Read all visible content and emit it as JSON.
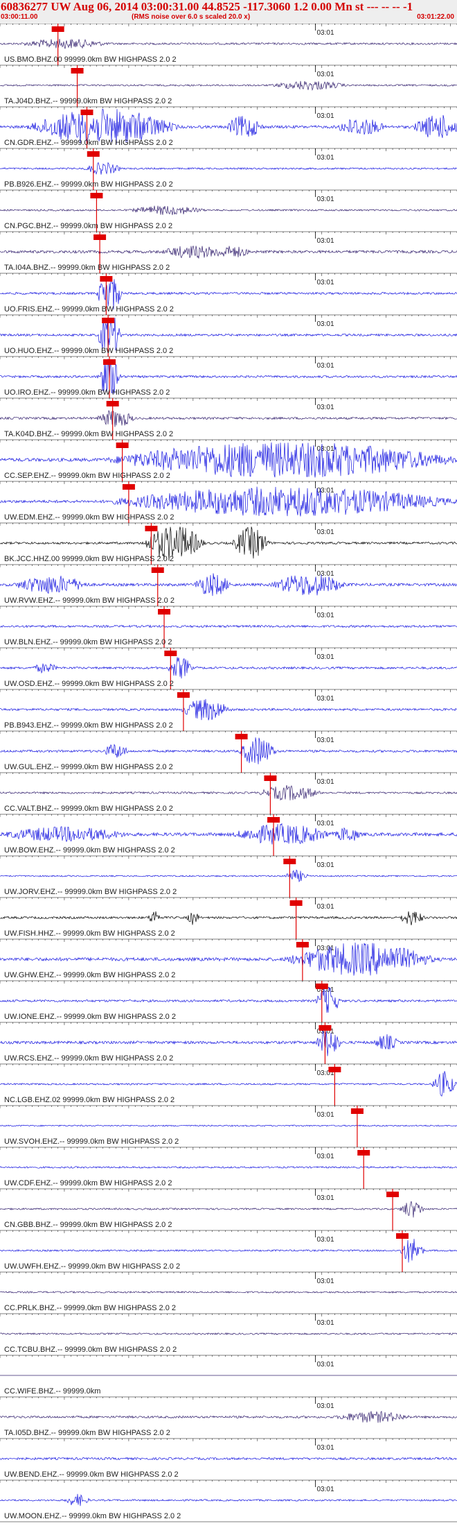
{
  "header": {
    "title": "60836277 UW Aug 06, 2014 03:00:31.00   44.8525 -117.3060  1.2 0.00 Mn st --- -- --   -1",
    "start_time": "03:00:11.00",
    "noise_note": "(RMS noise over 6.0 s scaled 20.0 x)",
    "end_time": "03:01:22.00"
  },
  "chart_data": {
    "type": "line",
    "title": "60836277 UW Aug 06, 2014 03:00:31.00   44.8525 -117.3060  1.2 0.00 Mn st --- -- --   -1",
    "xlim_seconds": [
      0,
      71
    ],
    "x_tick_label": "03:01",
    "colors": {
      "trace_blue": "#1515e0",
      "trace_dark": "#33206e",
      "trace_black": "#000000",
      "pick_red": "#e00000",
      "text": "#222222"
    },
    "channels": [
      {
        "label": "US.BMO.BHZ.00 99999.0km BW  HIGHPASS  2.0  2",
        "color": "trace_dark",
        "pick_s": 9.0,
        "amp": 0.35,
        "bursts": [
          [
            10,
            7,
            0.6
          ]
        ]
      },
      {
        "label": "TA.J04D.BHZ.-- 99999.0km BW  HIGHPASS  2.0  2",
        "color": "trace_dark",
        "pick_s": 12.0,
        "amp": 0.3,
        "bursts": [
          [
            48,
            6,
            0.6
          ]
        ]
      },
      {
        "label": "CN.GDR.EHZ.-- 99999.0km BW  HIGHPASS  2.0  2",
        "color": "trace_blue",
        "pick_s": 13.5,
        "amp": 0.5,
        "bursts": [
          [
            16,
            12,
            2.5
          ],
          [
            38,
            3,
            1.5
          ],
          [
            56,
            4,
            1.2
          ],
          [
            68,
            4,
            1.6
          ]
        ]
      },
      {
        "label": "PB.B926.EHZ.-- 99999.0km BW  HIGHPASS  2.0  2",
        "color": "trace_blue",
        "pick_s": 14.5,
        "amp": 0.3,
        "bursts": [
          [
            16,
            3,
            0.8
          ]
        ]
      },
      {
        "label": "CN.PGC.BHZ.-- 99999.0km BW  HIGHPASS  2.0  2",
        "color": "trace_dark",
        "pick_s": 15.0,
        "amp": 0.3,
        "bursts": [
          [
            26,
            6,
            0.6
          ]
        ]
      },
      {
        "label": "TA.I04A.BHZ.-- 99999.0km BW  HIGHPASS  2.0  2",
        "color": "trace_dark",
        "pick_s": 15.5,
        "amp": 0.5,
        "bursts": [
          [
            30,
            5,
            0.8
          ],
          [
            36,
            3,
            0.7
          ]
        ]
      },
      {
        "label": "UO.FRIS.EHZ.-- 99999.0km BW  HIGHPASS  2.0  2",
        "color": "trace_blue",
        "pick_s": 16.5,
        "amp": 0.4,
        "bursts": [
          [
            17,
            2,
            3.0
          ]
        ]
      },
      {
        "label": "UO.HUO.EHZ.-- 99999.0km BW  HIGHPASS  2.0  2",
        "color": "trace_blue",
        "pick_s": 16.8,
        "amp": 0.4,
        "bursts": [
          [
            17,
            2,
            3.0
          ]
        ]
      },
      {
        "label": "UO.IRO.EHZ.-- 99999.0km BW  HIGHPASS  2.0  2",
        "color": "trace_blue",
        "pick_s": 17.0,
        "amp": 0.4,
        "bursts": [
          [
            17,
            2,
            3.0
          ]
        ]
      },
      {
        "label": "TA.K04D.BHZ.-- 99999.0km BW  HIGHPASS  2.0  2",
        "color": "trace_dark",
        "pick_s": 17.5,
        "amp": 0.4,
        "bursts": [
          [
            18,
            3,
            1.2
          ]
        ]
      },
      {
        "label": "CC.SEP.EHZ.-- 99999.0km BW  HIGHPASS  2.0  2",
        "color": "trace_blue",
        "pick_s": 19.0,
        "amp": 0.6,
        "bursts": [
          [
            44,
            28,
            2.5
          ]
        ]
      },
      {
        "label": "UW.EDM.EHZ.-- 99999.0km BW  HIGHPASS  2.0  2",
        "color": "trace_blue",
        "pick_s": 20.0,
        "amp": 0.5,
        "bursts": [
          [
            44,
            28,
            2.0
          ]
        ]
      },
      {
        "label": "BK.JCC.HHZ.00 99999.0km BW  HIGHPASS  2.0  2",
        "color": "trace_black",
        "pick_s": 23.5,
        "amp": 0.4,
        "bursts": [
          [
            27,
            5,
            2.5
          ],
          [
            39,
            3,
            2.2
          ]
        ]
      },
      {
        "label": "UW.RVW.EHZ.-- 99999.0km BW  HIGHPASS  2.0  2",
        "color": "trace_blue",
        "pick_s": 24.5,
        "amp": 0.5,
        "bursts": [
          [
            8,
            6,
            1.2
          ],
          [
            33,
            3,
            1.5
          ],
          [
            48,
            6,
            1.5
          ]
        ]
      },
      {
        "label": "UW.BLN.EHZ.-- 99999.0km BW  HIGHPASS  2.0  2",
        "color": "trace_blue",
        "pick_s": 25.5,
        "amp": 0.4,
        "bursts": []
      },
      {
        "label": "UW.OSD.EHZ.-- 99999.0km BW  HIGHPASS  2.0  2",
        "color": "trace_blue",
        "pick_s": 26.5,
        "amp": 0.4,
        "bursts": [
          [
            28,
            2,
            1.5
          ],
          [
            7,
            2,
            0.6
          ]
        ]
      },
      {
        "label": "PB.B943.EHZ.-- 99999.0km BW  HIGHPASS  2.0  2",
        "color": "trace_blue",
        "pick_s": 28.5,
        "amp": 0.4,
        "bursts": [
          [
            32,
            4,
            1.5
          ]
        ]
      },
      {
        "label": "UW.GUL.EHZ.-- 99999.0km BW  HIGHPASS  2.0  2",
        "color": "trace_blue",
        "pick_s": 37.5,
        "amp": 0.4,
        "bursts": [
          [
            40,
            3,
            2.0
          ],
          [
            18,
            2,
            1.0
          ]
        ]
      },
      {
        "label": "CC.VALT.BHZ.-- 99999.0km BW  HIGHPASS  2.0  2",
        "color": "trace_dark",
        "pick_s": 42.0,
        "amp": 0.35,
        "bursts": [
          [
            45,
            5,
            1.0
          ]
        ]
      },
      {
        "label": "UW.BOW.EHZ.-- 99999.0km BW  HIGHPASS  2.0  2",
        "color": "trace_blue",
        "pick_s": 42.5,
        "amp": 0.6,
        "bursts": [
          [
            10,
            10,
            0.9
          ],
          [
            44,
            8,
            1.3
          ],
          [
            54,
            2,
            1.0
          ]
        ]
      },
      {
        "label": "UW.JORV.EHZ.-- 99999.0km BW  HIGHPASS  2.0  2",
        "color": "trace_blue",
        "pick_s": 45.0,
        "amp": 0.25,
        "bursts": [
          [
            46,
            2,
            0.8
          ]
        ]
      },
      {
        "label": "UW.FISH.HHZ.-- 99999.0km BW  HIGHPASS  2.0  2",
        "color": "trace_black",
        "pick_s": 46.0,
        "amp": 0.4,
        "bursts": [
          [
            24,
            1,
            1.0
          ],
          [
            30,
            1,
            0.9
          ],
          [
            64,
            2,
            1.0
          ]
        ]
      },
      {
        "label": "UW.GHW.EHZ.-- 99999.0km BW  HIGHPASS  2.0  2",
        "color": "trace_blue",
        "pick_s": 47.0,
        "amp": 0.6,
        "bursts": [
          [
            56,
            12,
            2.2
          ]
        ]
      },
      {
        "label": "UW.IONE.EHZ.-- 99999.0km BW  HIGHPASS  2.0  2",
        "color": "trace_blue",
        "pick_s": 50.0,
        "amp": 0.4,
        "bursts": [
          [
            51,
            2,
            2.0
          ]
        ]
      },
      {
        "label": "UW.RCS.EHZ.-- 99999.0km BW  HIGHPASS  2.0  2",
        "color": "trace_blue",
        "pick_s": 50.5,
        "amp": 0.5,
        "bursts": [
          [
            51,
            2,
            2.0
          ],
          [
            60,
            2,
            1.0
          ]
        ]
      },
      {
        "label": "NC.LGB.EHZ.02 99999.0km BW  HIGHPASS  2.0  2",
        "color": "trace_blue",
        "pick_s": 52.0,
        "amp": 0.3,
        "bursts": [
          [
            69,
            2,
            1.8
          ]
        ]
      },
      {
        "label": "UW.SVOH.EHZ.-- 99999.0km BW  HIGHPASS  2.0  2",
        "color": "trace_blue",
        "pick_s": 55.5,
        "amp": 0.25,
        "bursts": []
      },
      {
        "label": "UW.CDF.EHZ.-- 99999.0km BW  HIGHPASS  2.0  2",
        "color": "trace_blue",
        "pick_s": 56.5,
        "amp": 0.3,
        "bursts": []
      },
      {
        "label": "CN.GBB.BHZ.-- 99999.0km BW  HIGHPASS  2.0  2",
        "color": "trace_dark",
        "pick_s": 61.0,
        "amp": 0.3,
        "bursts": [
          [
            64,
            2,
            1.2
          ]
        ]
      },
      {
        "label": "UW.UWFH.EHZ.-- 99999.0km BW  HIGHPASS  2.0  2",
        "color": "trace_blue",
        "pick_s": 62.5,
        "amp": 0.3,
        "bursts": [
          [
            64,
            2,
            1.8
          ]
        ]
      },
      {
        "label": "CC.PRLK.BHZ.-- 99999.0km BW  HIGHPASS  2.0  2",
        "color": "trace_dark",
        "pick_s": null,
        "amp": 0.3,
        "bursts": []
      },
      {
        "label": "CC.TCBU.BHZ.-- 99999.0km BW  HIGHPASS  2.0  2",
        "color": "trace_dark",
        "pick_s": null,
        "amp": 0.3,
        "bursts": []
      },
      {
        "label": "CC.WIFE.BHZ.-- 99999.0km",
        "color": "trace_dark",
        "pick_s": null,
        "amp": 0.0,
        "bursts": []
      },
      {
        "label": "TA.I05D.BHZ.-- 99999.0km BW  HIGHPASS  2.0  2",
        "color": "trace_dark",
        "pick_s": null,
        "amp": 0.4,
        "bursts": [
          [
            58,
            6,
            0.7
          ]
        ]
      },
      {
        "label": "UW.BEND.EHZ.-- 99999.0km BW  HIGHPASS  2.0  2",
        "color": "trace_blue",
        "pick_s": null,
        "amp": 0.4,
        "bursts": []
      },
      {
        "label": "UW.MOON.EHZ.-- 99999.0km BW  HIGHPASS  2.0  2",
        "color": "trace_blue",
        "pick_s": null,
        "amp": 0.3,
        "bursts": [
          [
            12,
            2,
            0.8
          ]
        ]
      }
    ]
  }
}
